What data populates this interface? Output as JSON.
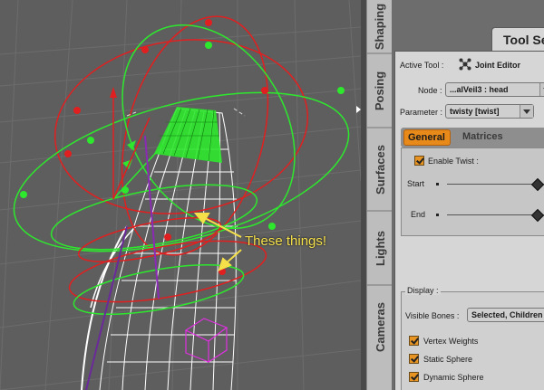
{
  "viewport": {
    "annotation": "These things!"
  },
  "side_tabs": [
    "Shaping",
    "Posing",
    "Surfaces",
    "Lights",
    "Cameras"
  ],
  "panel": {
    "title": "Tool Se",
    "active_tool_label": "Active Tool :",
    "active_tool_value": "Joint Editor",
    "node_label": "Node :",
    "node_value": "...alVeil3 : head",
    "parameter_label": "Parameter :",
    "parameter_value": "twisty [twist]",
    "tabs": [
      "General",
      "Matrices"
    ],
    "enable_twist_label": "Enable Twist :",
    "start_label": "Start",
    "end_label": "End",
    "display_label": "Display :",
    "visible_bones_label": "Visible Bones :",
    "visible_bones_value": "Selected, Children",
    "options": [
      "Vertex Weights",
      "Static Sphere",
      "Dynamic Sphere"
    ]
  },
  "colors": {
    "accent_orange": "#e88a1a",
    "viewport_bg": "#5e5e5e",
    "annotation_yellow": "#f5e04a"
  }
}
